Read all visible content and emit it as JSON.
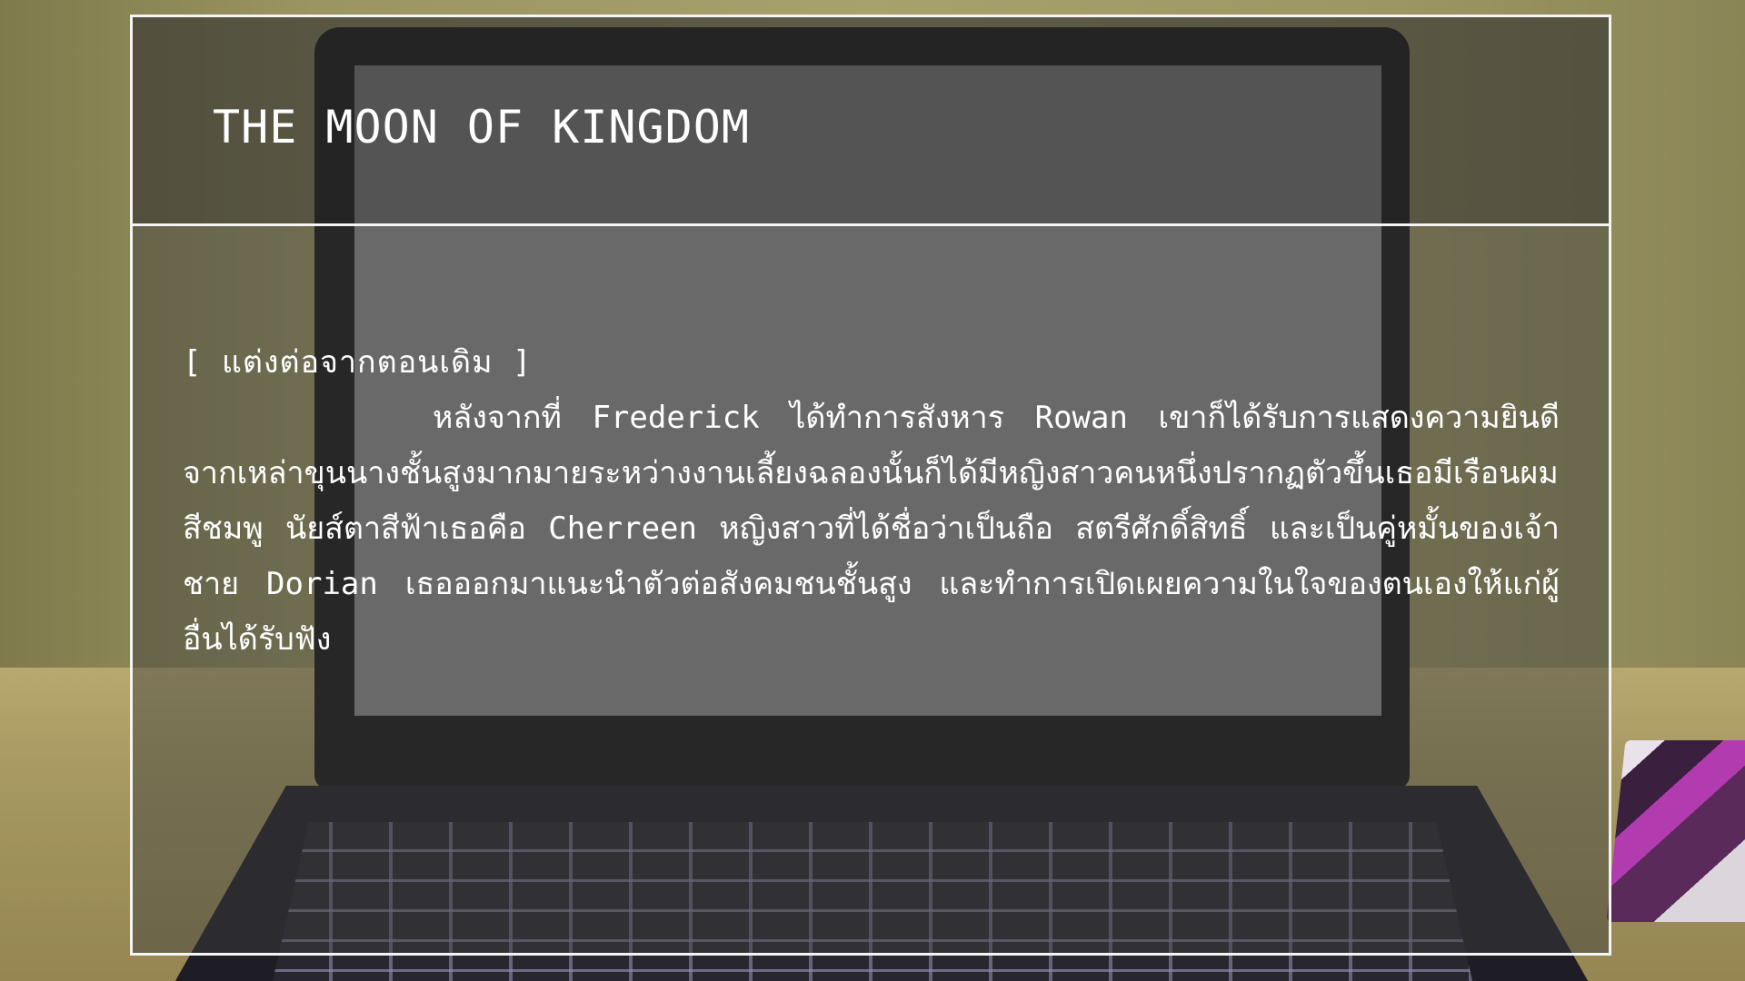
{
  "title": "THE MOON OF KINGDOM",
  "story": {
    "tag": "[ แต่งต่อจากตอนเดิม ]",
    "paragraph": "หลังจากที่ Frederick ได้ทำการสังหาร Rowan เขาก็ได้รับการแสดงความยินดีจากเหล่าขุนนางชั้นสูงมากมายระหว่างงานเลี้ยงฉลองนั้นก็ได้มีหญิงสาวคนหนึ่งปรากฏตัวขึ้นเธอมีเรือนผมสีชมพู นัยส์ตาสีฟ้าเธอคือ Cherreen หญิงสาวที่ได้ชื่อว่าเป็นถือ สตรีศักดิ์สิทธิ์ และเป็นคู่หมั้นของเจ้าชาย Dorian เธอออกมาแนะนำตัวต่อสังคมชนชั้นสูง และทำการเปิดเผยความในใจของตนเองให้แก่ผู้อื่นได้รับฟัง"
  },
  "colors": {
    "frame": "#f4f4f4",
    "text": "#ffffff"
  }
}
